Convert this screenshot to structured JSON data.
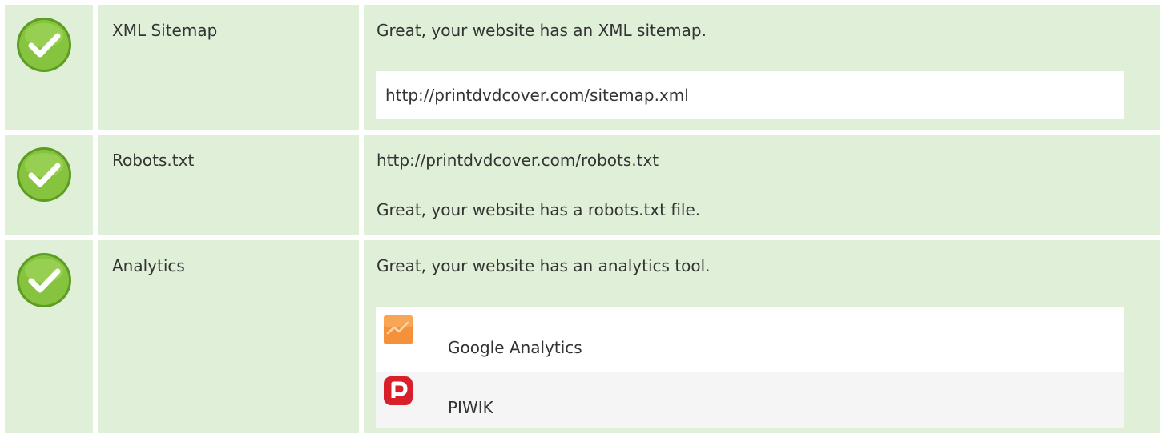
{
  "colors": {
    "row_background": "#e0f0d8",
    "check_green": "#86c440",
    "check_green_dark": "#5c9c22",
    "google_analytics_orange": "#f5913a",
    "piwik_red": "#d8202a"
  },
  "rows": [
    {
      "status_icon": "check-icon",
      "name": "XML Sitemap",
      "message": "Great, your website has an XML sitemap.",
      "url": "http://printdvdcover.com/sitemap.xml"
    },
    {
      "status_icon": "check-icon",
      "name": "Robots.txt",
      "url": "http://printdvdcover.com/robots.txt",
      "message": "Great, your website has a robots.txt file."
    },
    {
      "status_icon": "check-icon",
      "name": "Analytics",
      "message": "Great, your website has an analytics tool.",
      "tools": [
        {
          "icon": "google-analytics-icon",
          "label": "Google Analytics"
        },
        {
          "icon": "piwik-icon",
          "label": "PIWIK"
        }
      ]
    }
  ]
}
